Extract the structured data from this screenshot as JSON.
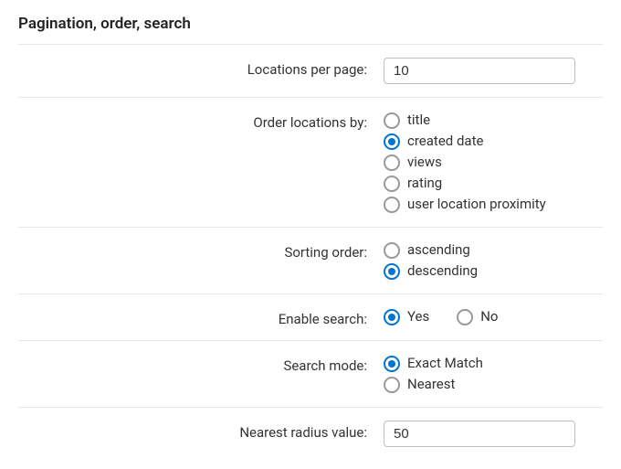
{
  "section_title": "Pagination, order, search",
  "locations_per_page": {
    "label": "Locations per page:",
    "value": "10"
  },
  "order_by": {
    "label": "Order locations by:",
    "options": [
      {
        "label": "title",
        "checked": false
      },
      {
        "label": "created date",
        "checked": true
      },
      {
        "label": "views",
        "checked": false
      },
      {
        "label": "rating",
        "checked": false
      },
      {
        "label": "user location proximity",
        "checked": false
      }
    ]
  },
  "sorting_order": {
    "label": "Sorting order:",
    "options": [
      {
        "label": "ascending",
        "checked": false
      },
      {
        "label": "descending",
        "checked": true
      }
    ]
  },
  "enable_search": {
    "label": "Enable search:",
    "options": [
      {
        "label": "Yes",
        "checked": true
      },
      {
        "label": "No",
        "checked": false
      }
    ]
  },
  "search_mode": {
    "label": "Search mode:",
    "options": [
      {
        "label": "Exact Match",
        "checked": true
      },
      {
        "label": "Nearest",
        "checked": false
      }
    ]
  },
  "nearest_radius": {
    "label": "Nearest radius value:",
    "value": "50"
  }
}
